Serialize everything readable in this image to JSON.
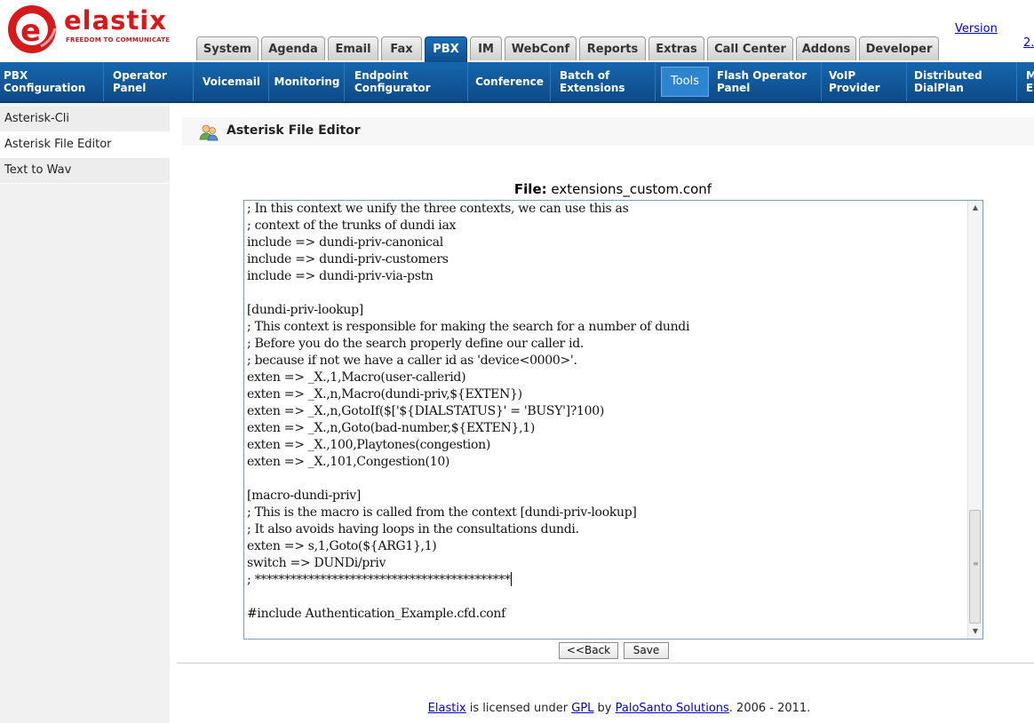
{
  "header": {
    "brand": "elastix",
    "tagline": "FREEDOM TO COMMUNICATE",
    "version_link": "Version",
    "version_number": "2.",
    "tabs": [
      {
        "label": "System"
      },
      {
        "label": "Agenda"
      },
      {
        "label": "Email"
      },
      {
        "label": "Fax"
      },
      {
        "label": "PBX"
      },
      {
        "label": "IM"
      },
      {
        "label": "WebConf"
      },
      {
        "label": "Reports"
      },
      {
        "label": "Extras"
      },
      {
        "label": "Call Center"
      },
      {
        "label": "Addons"
      },
      {
        "label": "Developer"
      }
    ],
    "active_tab": "PBX"
  },
  "menu": {
    "items": [
      {
        "label": "PBX\nConfiguration"
      },
      {
        "label": "Operator\nPanel"
      },
      {
        "label": "Voicemail"
      },
      {
        "label": "Monitoring"
      },
      {
        "label": "Endpoint\nConfigurator"
      },
      {
        "label": "Conference"
      },
      {
        "label": "Batch of\nExtensions"
      },
      {
        "label": "Tools"
      },
      {
        "label": "Flash Operator\nPanel"
      },
      {
        "label": "VoIP\nProvider"
      },
      {
        "label": "Distributed\nDialPlan"
      },
      {
        "label": "M\nE"
      }
    ],
    "active_item": "Tools"
  },
  "sidebar": {
    "items": [
      {
        "label": "Asterisk-Cli"
      },
      {
        "label": "Asterisk File Editor"
      },
      {
        "label": "Text to Wav"
      }
    ],
    "active_item": "Asterisk File Editor"
  },
  "main": {
    "title": "Asterisk File Editor",
    "file_label": "File:",
    "file_name": "extensions_custom.conf",
    "editor_lines": [
      "; In this context we unify the three contexts, we can use this as",
      "; context of the trunks of dundi iax",
      "include => dundi-priv-canonical",
      "include => dundi-priv-customers",
      "include => dundi-priv-via-pstn",
      "",
      "[dundi-priv-lookup]",
      "; This context is responsible for making the search for a number of dundi",
      "; Before you do the search properly define our caller id.",
      "; because if not we have a caller id as 'device<0000>'.",
      "exten => _X.,1,Macro(user-callerid)",
      "exten => _X.,n,Macro(dundi-priv,${EXTEN})",
      "exten => _X.,n,GotoIf($['${DIALSTATUS}' = 'BUSY']?100)",
      "exten => _X.,n,Goto(bad-number,${EXTEN},1)",
      "exten => _X.,100,Playtones(congestion)",
      "exten => _X.,101,Congestion(10)",
      "",
      "[macro-dundi-priv]",
      "; This is the macro is called from the context [dundi-priv-lookup]",
      "; It also avoids having loops in the consultations dundi.",
      "exten => s,1,Goto(${ARG1},1)",
      "switch => DUNDi/priv",
      "; *******************************************",
      "",
      "#include Authentication_Example.cfd.conf"
    ],
    "back_button": "<<Back",
    "save_button": "Save"
  },
  "footer": {
    "elastix_link": "Elastix",
    "text1": " is licensed under ",
    "gpl_link": "GPL",
    "text2": " by ",
    "palosanto_link": "PaloSanto Solutions",
    "text3": ". 2006 - 2011."
  },
  "colors": {
    "brand_red": "#d41a1a",
    "menu_blue": "#1666ad",
    "active_tab_blue": "#1a6fb8",
    "link_blue": "#0000cc"
  }
}
